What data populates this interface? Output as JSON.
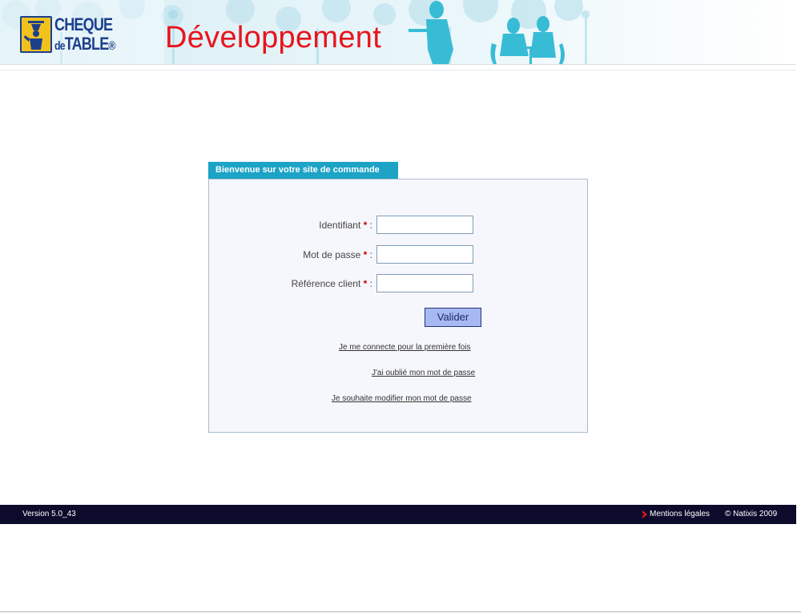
{
  "header": {
    "logo": {
      "line1": "CHEQUE",
      "line2_small": "de",
      "line2": "TABLE",
      "mark": "®"
    },
    "environment_label": "Développement"
  },
  "login_panel": {
    "title": "Bienvenue sur votre site de commande",
    "required_mark": "*",
    "separator": ":",
    "fields": {
      "identifiant": {
        "label": "Identifiant",
        "value": "",
        "placeholder": ""
      },
      "mot_de_passe": {
        "label": "Mot de passe",
        "value": "",
        "placeholder": ""
      },
      "reference_client": {
        "label": "Référence client",
        "value": "",
        "placeholder": ""
      }
    },
    "submit_label": "Valider",
    "links": {
      "first_login": "Je me connecte pour la première fois",
      "forgot_password": "J'ai oublié mon mot de passe",
      "change_password": "Je souhaite modifier mon mot de passe"
    }
  },
  "footer": {
    "version": "Version 5.0_43",
    "legal_link": "Mentions légales",
    "copyright": "© Natixis 2009"
  },
  "colors": {
    "banner_text": "#e8141c",
    "tab_background": "#1ca3c6",
    "button_background": "#a6b9f2",
    "footer_background": "#0d0b2c",
    "logo_blue": "#1c3f8c",
    "logo_yellow": "#f2c21c"
  },
  "icons": [
    "logo-waiter-icon",
    "footer-chevron-icon"
  ]
}
